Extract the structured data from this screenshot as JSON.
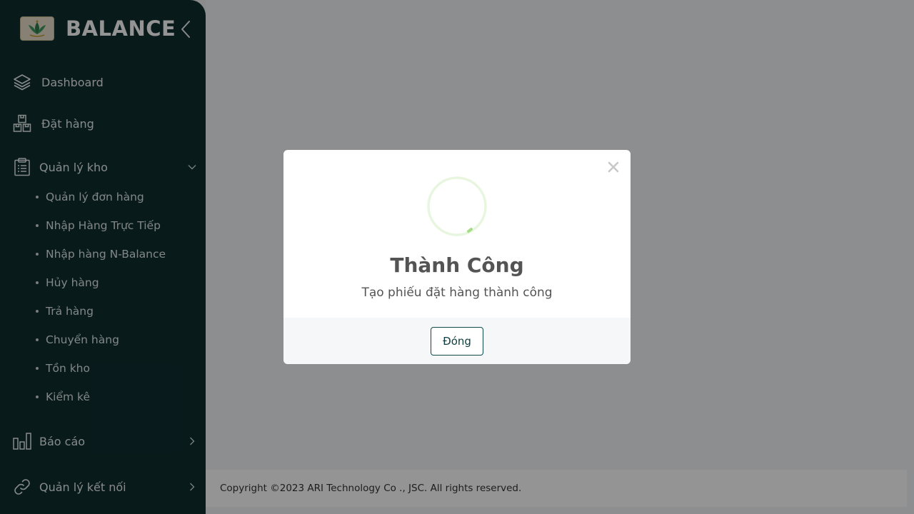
{
  "brand": {
    "name": "BALANCE"
  },
  "nav": {
    "dashboard": "Dashboard",
    "order": "Đặt hàng",
    "warehouse": "Quản lý kho",
    "warehouse_items": [
      "Quản lý đơn hàng",
      "Nhập Hàng Trực Tiếp",
      "Nhập hàng N-Balance",
      "Hủy hàng",
      "Trả hàng",
      "Chuyển hàng",
      "Tồn kho",
      "Kiểm kê"
    ],
    "reports": "Báo cáo",
    "connections": "Quản lý kết nối"
  },
  "footer": {
    "copyright": "Copyright ©2023 ARI Technology Co ., JSC. All rights reserved."
  },
  "modal": {
    "title": "Thành Công",
    "message": "Tạo phiếu đặt hàng thành công",
    "close_button": "Đóng"
  },
  "colors": {
    "sidebar_bg": "#0e2d2e",
    "accent": "#0e4a4c",
    "success": "#a5dc86"
  }
}
